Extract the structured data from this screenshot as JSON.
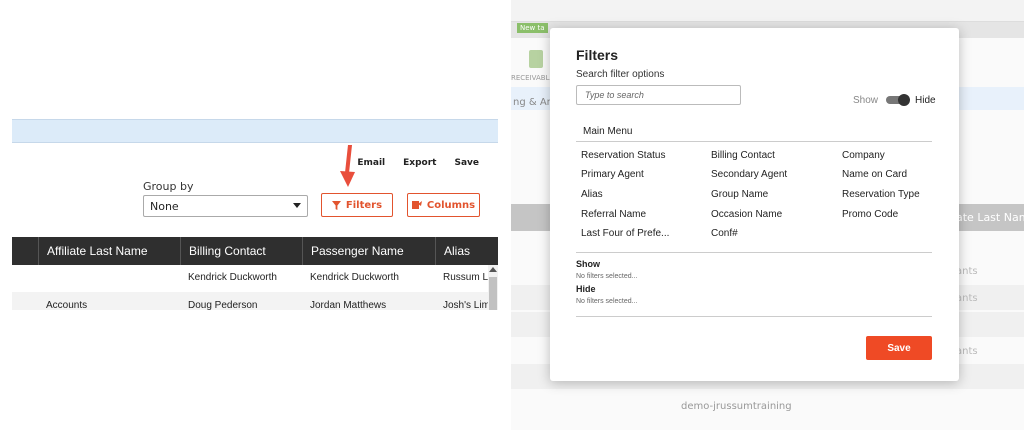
{
  "left": {
    "toolbar": {
      "email": "Email",
      "export": "Export",
      "save": "Save"
    },
    "group_by": {
      "label": "Group by",
      "value": "None"
    },
    "buttons": {
      "filters": "Filters",
      "columns": "Columns"
    },
    "table": {
      "headers": [
        "Affiliate Last Name",
        "Billing Contact",
        "Passenger Name",
        "Alias"
      ],
      "rows": [
        [
          "",
          "Kendrick Duckworth",
          "Kendrick Duckworth",
          "Russum Lir"
        ],
        [
          "Accounts",
          "Doug Pederson",
          "Jordan Matthews",
          "Josh's Limo"
        ]
      ]
    }
  },
  "background": {
    "new_tab": "New ta",
    "receivable": "RECEIVABL",
    "analytics": "ng & Ana",
    "last_name_header": "ate Last Nam",
    "row_text": "ants",
    "footer": "demo-jrussumtraining"
  },
  "modal": {
    "title": "Filters",
    "subtitle": "Search filter options",
    "search_placeholder": "Type to search",
    "toggle_show": "Show",
    "toggle_hide": "Hide",
    "main_menu": "Main Menu",
    "options": [
      [
        "Reservation Status",
        "Billing Contact",
        "Company"
      ],
      [
        "Primary Agent",
        "Secondary Agent",
        "Name on Card"
      ],
      [
        "Alias",
        "Group Name",
        "Reservation Type"
      ],
      [
        "Referral Name",
        "Occasion Name",
        "Promo Code"
      ],
      [
        "Last Four of Prefe...",
        "Conf#",
        ""
      ]
    ],
    "show_label": "Show",
    "show_empty": "No filters selected...",
    "hide_label": "Hide",
    "hide_empty": "No filters selected...",
    "save": "Save"
  },
  "colors": {
    "accent": "#ef4a25",
    "header_dark": "#2f2f2f",
    "blue_bar": "#dcebf9"
  }
}
